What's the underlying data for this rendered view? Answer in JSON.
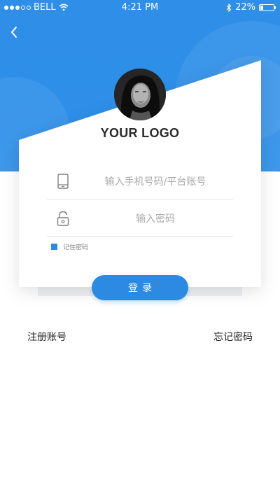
{
  "status_bar": {
    "carrier": "BELL",
    "time": "4:21 PM",
    "battery": "22%",
    "battery_level": 0.22,
    "icons": [
      "signal-dots-icon",
      "wifi-icon",
      "bluetooth-icon",
      "battery-icon"
    ]
  },
  "header": {
    "back_icon": "chevron-left-icon",
    "logo_text": "YOUR LOGO"
  },
  "form": {
    "phone": {
      "placeholder": "输入手机号码/平台账号",
      "value": "",
      "icon": "phone-icon"
    },
    "password": {
      "placeholder": "输入密码",
      "value": "",
      "icon": "lock-icon"
    },
    "remember_label": "记住密码",
    "remember_checked": true,
    "login_button": "登录"
  },
  "links": {
    "register": "注册账号",
    "forgot_password": "忘记密码"
  },
  "colors": {
    "primary": "#2d8ae3",
    "hero": "#2f8fe8",
    "text": "#222222",
    "placeholder": "#a9a9a9"
  }
}
